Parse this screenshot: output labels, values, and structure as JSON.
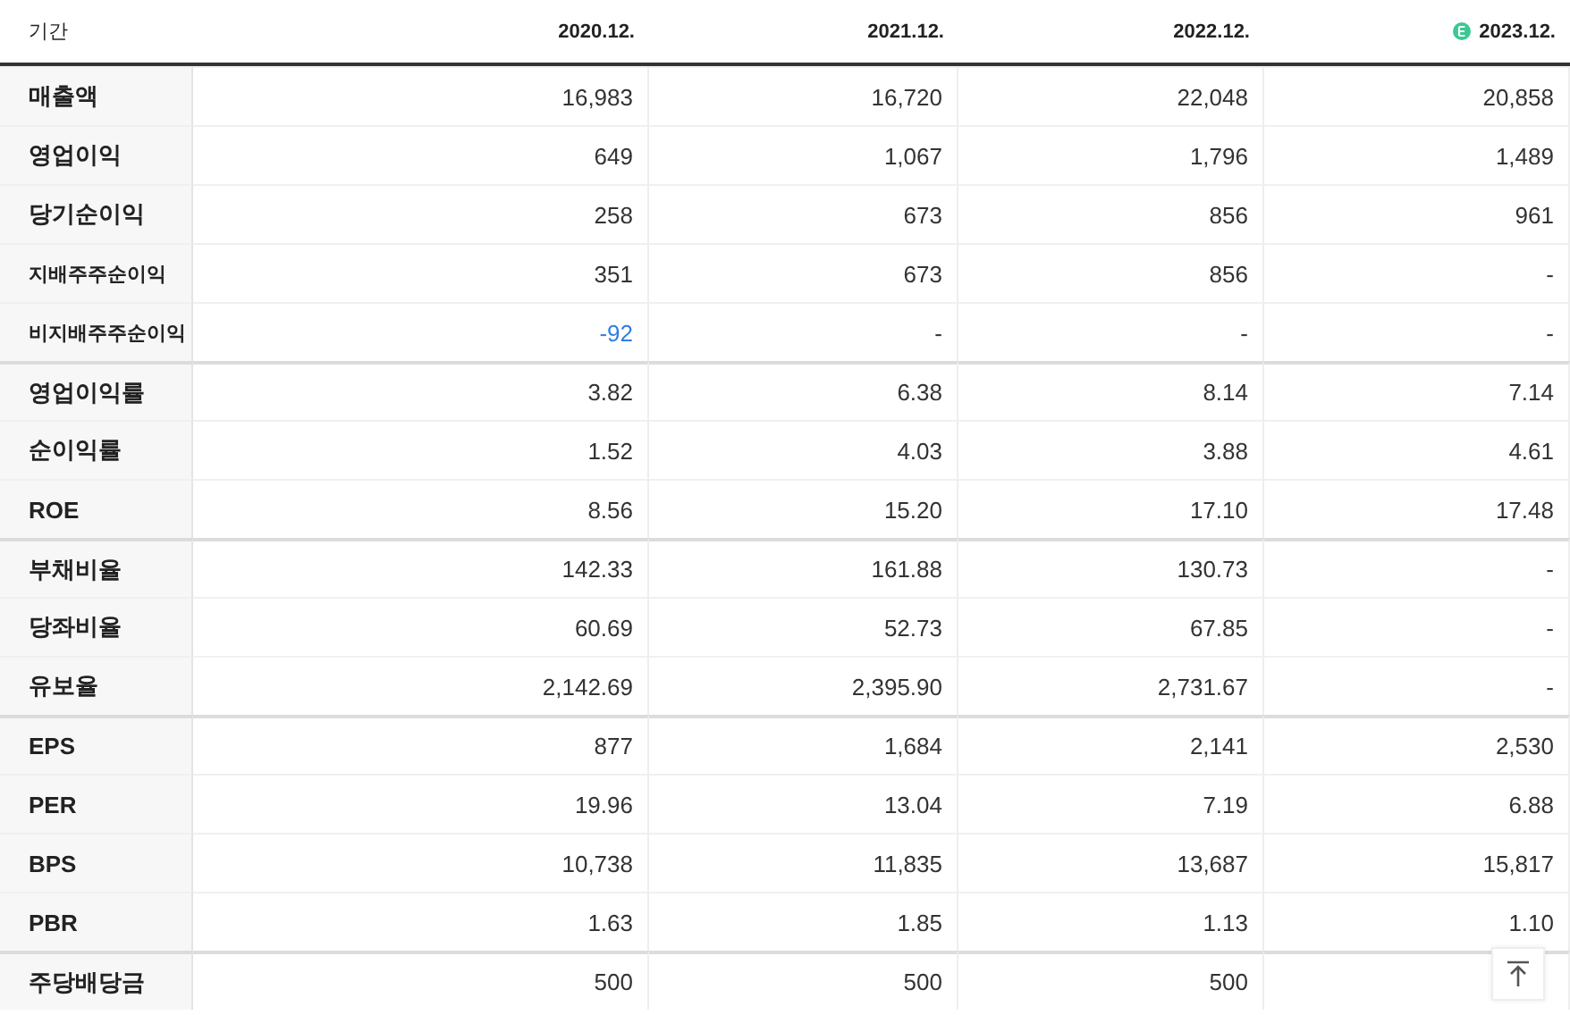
{
  "table": {
    "period_label": "기간",
    "columns": [
      {
        "label": "2020.12.",
        "estimate": false
      },
      {
        "label": "2021.12.",
        "estimate": false
      },
      {
        "label": "2022.12.",
        "estimate": false
      },
      {
        "label": "2023.12.",
        "estimate": true
      }
    ],
    "rows": [
      {
        "label": "매출액",
        "kind": "main",
        "group_start": false,
        "values": [
          "16,983",
          "16,720",
          "22,048",
          "20,858"
        ]
      },
      {
        "label": "영업이익",
        "kind": "main",
        "group_start": false,
        "values": [
          "649",
          "1,067",
          "1,796",
          "1,489"
        ]
      },
      {
        "label": "당기순이익",
        "kind": "main",
        "group_start": false,
        "values": [
          "258",
          "673",
          "856",
          "961"
        ]
      },
      {
        "label": "지배주주순이익",
        "kind": "sub",
        "group_start": false,
        "values": [
          "351",
          "673",
          "856",
          "-"
        ]
      },
      {
        "label": "비지배주주순이익",
        "kind": "sub",
        "group_start": false,
        "values": [
          {
            "text": "-92",
            "color": "#2f7fe0"
          },
          "-",
          "-",
          "-"
        ]
      },
      {
        "label": "영업이익률",
        "kind": "main",
        "group_start": true,
        "values": [
          "3.82",
          "6.38",
          "8.14",
          "7.14"
        ]
      },
      {
        "label": "순이익률",
        "kind": "main",
        "group_start": false,
        "values": [
          "1.52",
          "4.03",
          "3.88",
          "4.61"
        ]
      },
      {
        "label": "ROE",
        "kind": "main",
        "group_start": false,
        "values": [
          "8.56",
          "15.20",
          "17.10",
          "17.48"
        ]
      },
      {
        "label": "부채비율",
        "kind": "main",
        "group_start": true,
        "values": [
          "142.33",
          "161.88",
          "130.73",
          "-"
        ]
      },
      {
        "label": "당좌비율",
        "kind": "main",
        "group_start": false,
        "values": [
          "60.69",
          "52.73",
          "67.85",
          "-"
        ]
      },
      {
        "label": "유보율",
        "kind": "main",
        "group_start": false,
        "values": [
          "2,142.69",
          "2,395.90",
          "2,731.67",
          "-"
        ]
      },
      {
        "label": "EPS",
        "kind": "main",
        "group_start": true,
        "values": [
          "877",
          "1,684",
          "2,141",
          "2,530"
        ]
      },
      {
        "label": "PER",
        "kind": "main",
        "group_start": false,
        "values": [
          "19.96",
          "13.04",
          "7.19",
          "6.88"
        ]
      },
      {
        "label": "BPS",
        "kind": "main",
        "group_start": false,
        "values": [
          "10,738",
          "11,835",
          "13,687",
          "15,817"
        ]
      },
      {
        "label": "PBR",
        "kind": "main",
        "group_start": false,
        "values": [
          "1.63",
          "1.85",
          "1.13",
          "1.10"
        ]
      },
      {
        "label": "주당배당금",
        "kind": "main",
        "group_start": true,
        "values": [
          "500",
          "500",
          "500"
        ]
      }
    ]
  },
  "scroll_top_button": {
    "visible": true
  }
}
